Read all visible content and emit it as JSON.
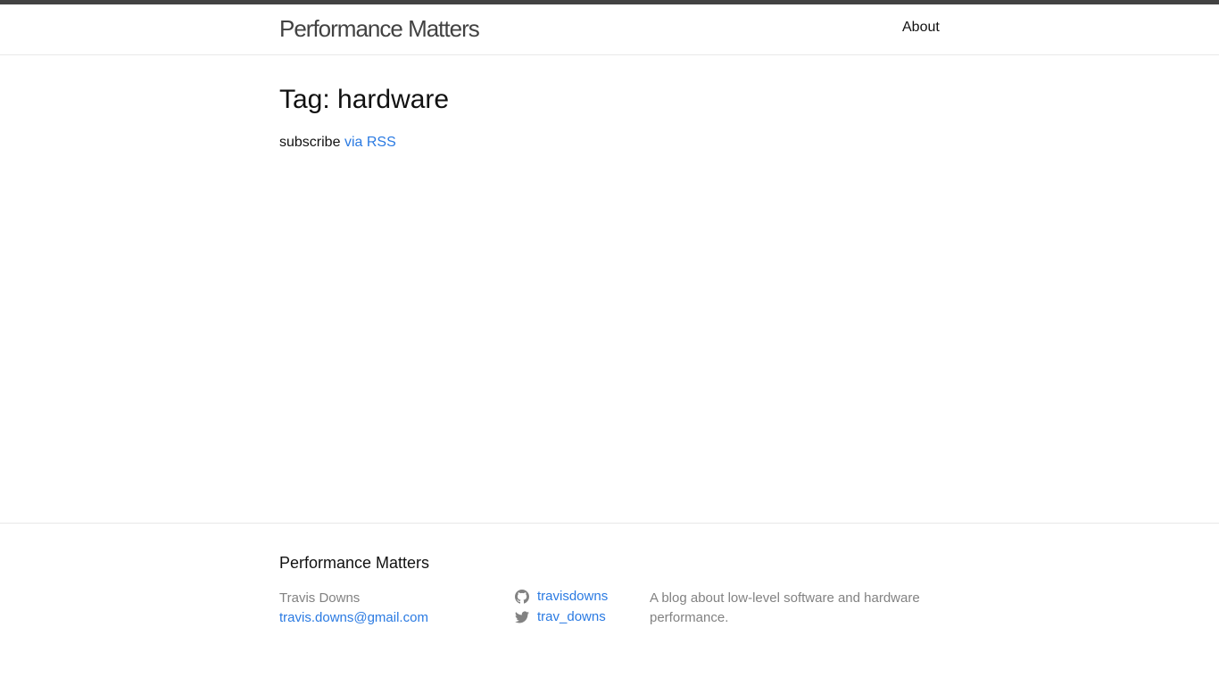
{
  "header": {
    "site_title": "Performance Matters",
    "nav": [
      {
        "label": "About"
      }
    ]
  },
  "main": {
    "heading": "Tag: hardware",
    "subscribe_text": "subscribe",
    "rss_link": "via RSS"
  },
  "footer": {
    "heading": "Performance Matters",
    "author_name": "Travis Downs",
    "email": "travis.downs@gmail.com",
    "social": [
      {
        "icon": "github-icon",
        "label": "travisdowns"
      },
      {
        "icon": "twitter-icon",
        "label": "trav_downs"
      }
    ],
    "description": "A blog about low-level software and hardware performance."
  },
  "colors": {
    "accent_link": "#2a7ae2",
    "header_stripe": "#424242",
    "muted_text": "#828282"
  }
}
